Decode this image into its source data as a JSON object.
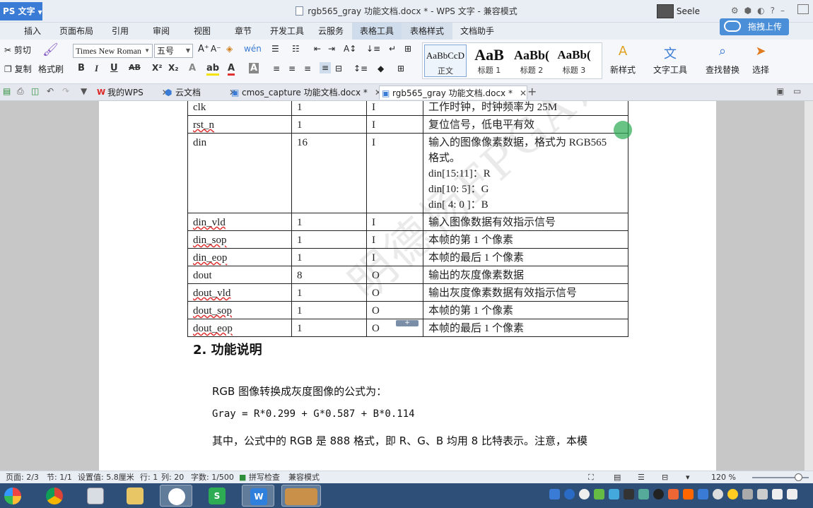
{
  "app": {
    "name": "PS 文字",
    "window_title": "rgb565_gray 功能文档.docx * - WPS 文字 - 兼容模式",
    "user": "Seele"
  },
  "ribbon_tabs": [
    "插入",
    "页面布局",
    "引用",
    "审阅",
    "视图",
    "章节",
    "开发工具",
    "云服务",
    "表格工具",
    "表格样式",
    "文档助手"
  ],
  "upload_label": "拖拽上传",
  "toolbar": {
    "cut": "剪切",
    "copy": "复制",
    "format_painter": "格式刷",
    "font": "Times New Roman",
    "size": "五号",
    "new_style": "新样式",
    "text_tools": "文字工具",
    "find_replace": "查找替换",
    "select": "选择"
  },
  "styles": [
    {
      "sample": "AaBbCcD",
      "label": "正文"
    },
    {
      "sample": "AaB",
      "label": "标题 1"
    },
    {
      "sample": "AaBb(",
      "label": "标题 2"
    },
    {
      "sample": "AaBb(",
      "label": "标题 3"
    }
  ],
  "doc_tabs": [
    {
      "label": "我的WPS"
    },
    {
      "label": "云文档"
    },
    {
      "label": "cmos_capture 功能文档.docx *"
    },
    {
      "label": "rgb565_gray 功能文档.docx *"
    }
  ],
  "port_table": {
    "rows": [
      {
        "name": "clk",
        "width": "1",
        "dir": "I",
        "desc": [
          "工作时钟，时钟频率为 25M"
        ]
      },
      {
        "name": "rst_n",
        "width": "1",
        "dir": "I",
        "desc": [
          "复位信号，低电平有效"
        ]
      },
      {
        "name": "din",
        "width": "16",
        "dir": "I",
        "desc": [
          "输入的图像像素数据，格式为 RGB565",
          "格式。",
          "din[15:11]：R",
          "din[10: 5]：G",
          "din[ 4: 0 ]：B"
        ]
      },
      {
        "name": "din_vld",
        "width": "1",
        "dir": "I",
        "desc": [
          "输入图像数据有效指示信号"
        ]
      },
      {
        "name": "din_sop",
        "width": "1",
        "dir": "I",
        "desc": [
          "本帧的第 1 个像素"
        ]
      },
      {
        "name": "din_eop",
        "width": "1",
        "dir": "I",
        "desc": [
          "本帧的最后 1 个像素"
        ]
      },
      {
        "name": "dout",
        "width": "8",
        "dir": "O",
        "desc": [
          "输出的灰度像素数据"
        ]
      },
      {
        "name": "dout_vld",
        "width": "1",
        "dir": "O",
        "desc": [
          "输出灰度像素数据有效指示信号"
        ]
      },
      {
        "name": "dout_sop",
        "width": "1",
        "dir": "O",
        "desc": [
          "本帧的第 1 个像素"
        ]
      },
      {
        "name": "dout_eop",
        "width": "1",
        "dir": "O",
        "desc": [
          "本帧的最后 1 个像素"
        ]
      }
    ]
  },
  "section": {
    "heading": "2.  功能说明",
    "para1": "RGB 图像转换成灰度图像的公式为：",
    "formula": "Gray = R*0.299 + G*0.587 + B*0.114",
    "para2": "其中，公式中的 RGB 是 888 格式，即 R、G、B 均用 8 比特表示。注意，本模"
  },
  "statusbar": {
    "page": "页面: 2/3",
    "section": "节: 1/1",
    "setting": "设置值: 5.8厘米",
    "row": "行: 1",
    "col": "列: 20",
    "words": "字数: 1/500",
    "spellcheck": "拼写检查",
    "compat": "兼容模式",
    "zoom": "120 %"
  },
  "colors": {
    "accent": "#3a7bd5",
    "taskbar": "#2d4f78",
    "spell_underline": "#e03030"
  }
}
